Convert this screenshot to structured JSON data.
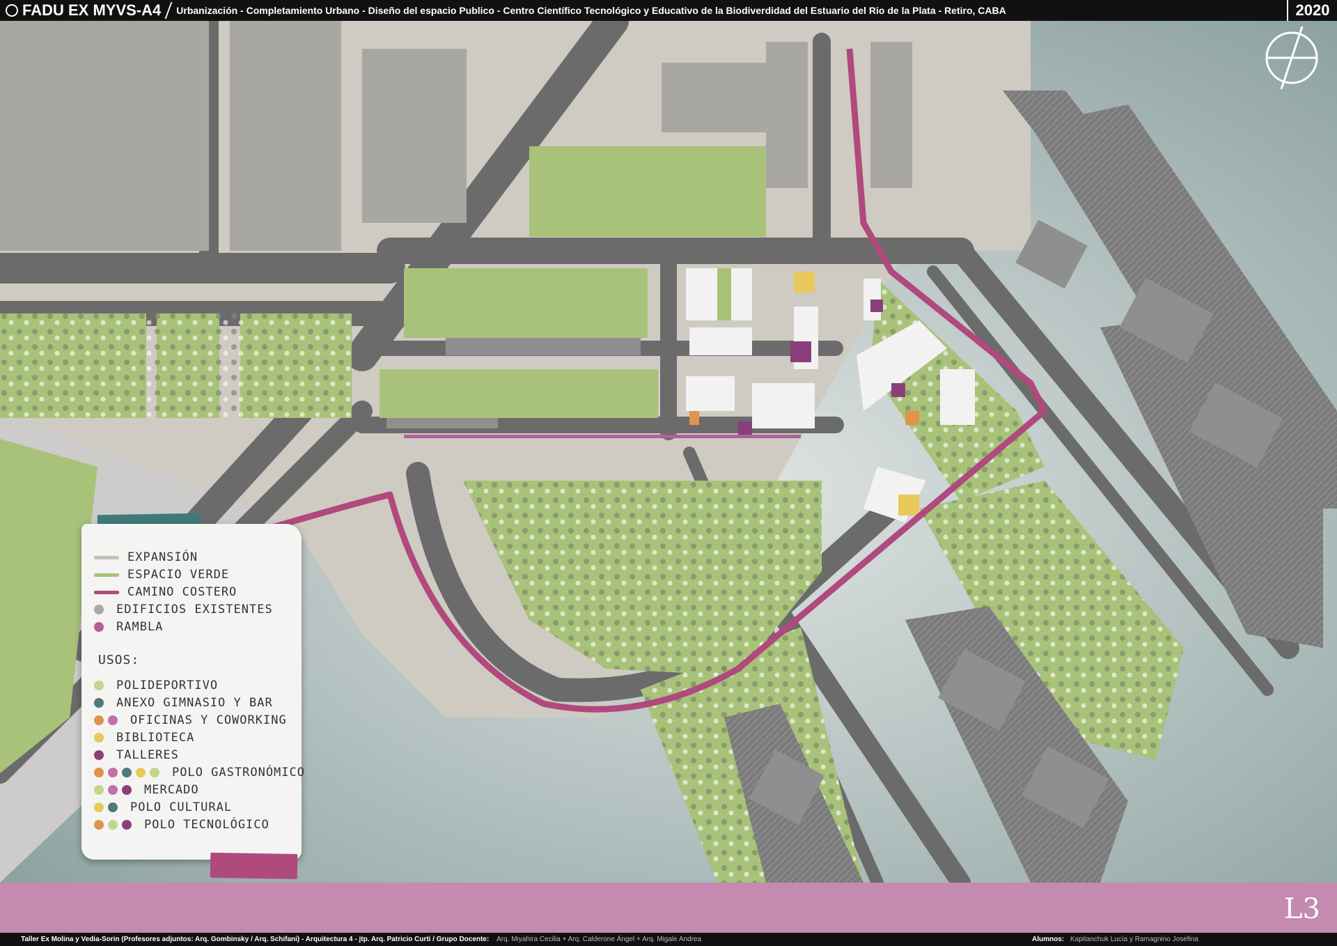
{
  "header": {
    "brand": "FADU EX MYVS-A4",
    "subtitle": "Urbanización - Completamiento Urbano - Diseño del espacio Publico - Centro Científico Tecnológico y Educativo de la Biodiverdidad del Estuario del Rio de la Plata  - Retiro, CABA",
    "year": "2020"
  },
  "legend": {
    "items": [
      {
        "label": "EXPANSIÓN",
        "color": "#c4c0b6"
      },
      {
        "label": "ESPACIO VERDE",
        "color": "#a8c27a"
      },
      {
        "label": "CAMINO COSTERO",
        "color": "#b0497d"
      },
      {
        "label": "EDIFICIOS EXISTENTES",
        "color": "#a8a8a8"
      },
      {
        "label": "RAMBLA",
        "color": "#b0609a"
      }
    ],
    "usos_title": "USOS:",
    "usos": [
      {
        "label": "POLIDEPORTIVO",
        "dots": [
          "#c2d68a"
        ]
      },
      {
        "label": "ANEXO GIMNASIO Y BAR",
        "dots": [
          "#4e7a7a"
        ]
      },
      {
        "label": "OFICINAS Y COWORKING",
        "dots": [
          "#e0944a",
          "#c270a8"
        ]
      },
      {
        "label": "BIBLIOTECA",
        "dots": [
          "#e8c85a"
        ]
      },
      {
        "label": "TALLERES",
        "dots": [
          "#8a3f7a"
        ]
      },
      {
        "label": "POLO GASTRONÓMICO",
        "dots": [
          "#e0944a",
          "#c270a8",
          "#4e7a7a",
          "#e8c85a",
          "#c2d68a"
        ]
      },
      {
        "label": "MERCADO",
        "dots": [
          "#c2d68a",
          "#c270a8",
          "#8a3f7a"
        ]
      },
      {
        "label": "POLO CULTURAL",
        "dots": [
          "#e8c85a",
          "#4e7a7a"
        ]
      },
      {
        "label": "POLO TECNOLÓGICO",
        "dots": [
          "#e0944a",
          "#c2d68a",
          "#8a3f7a"
        ]
      }
    ]
  },
  "sheet_code": "L3",
  "footer": {
    "left": "Taller Ex Molina y Vedia-Sorin (Profesores adjuntos:  Arq. Gombinsky / Arq. Schifani) - Arquitectura 4 - jtp. Arq. Patricio Curti / Grupo Docente:",
    "team": "Arq. Miyahira Cecilia + Arq. Calderone Ángel + Arq. Migale Andrea",
    "right": "Alumnos:",
    "students": "Kapitanchuk Lucía y Ramagnino Josefina"
  },
  "colors": {
    "water": "#9fb0ae",
    "road": "#6e6e6e",
    "block": "#c4c0b6",
    "green": "#a8c27a",
    "coastal_path": "#b0497d"
  }
}
